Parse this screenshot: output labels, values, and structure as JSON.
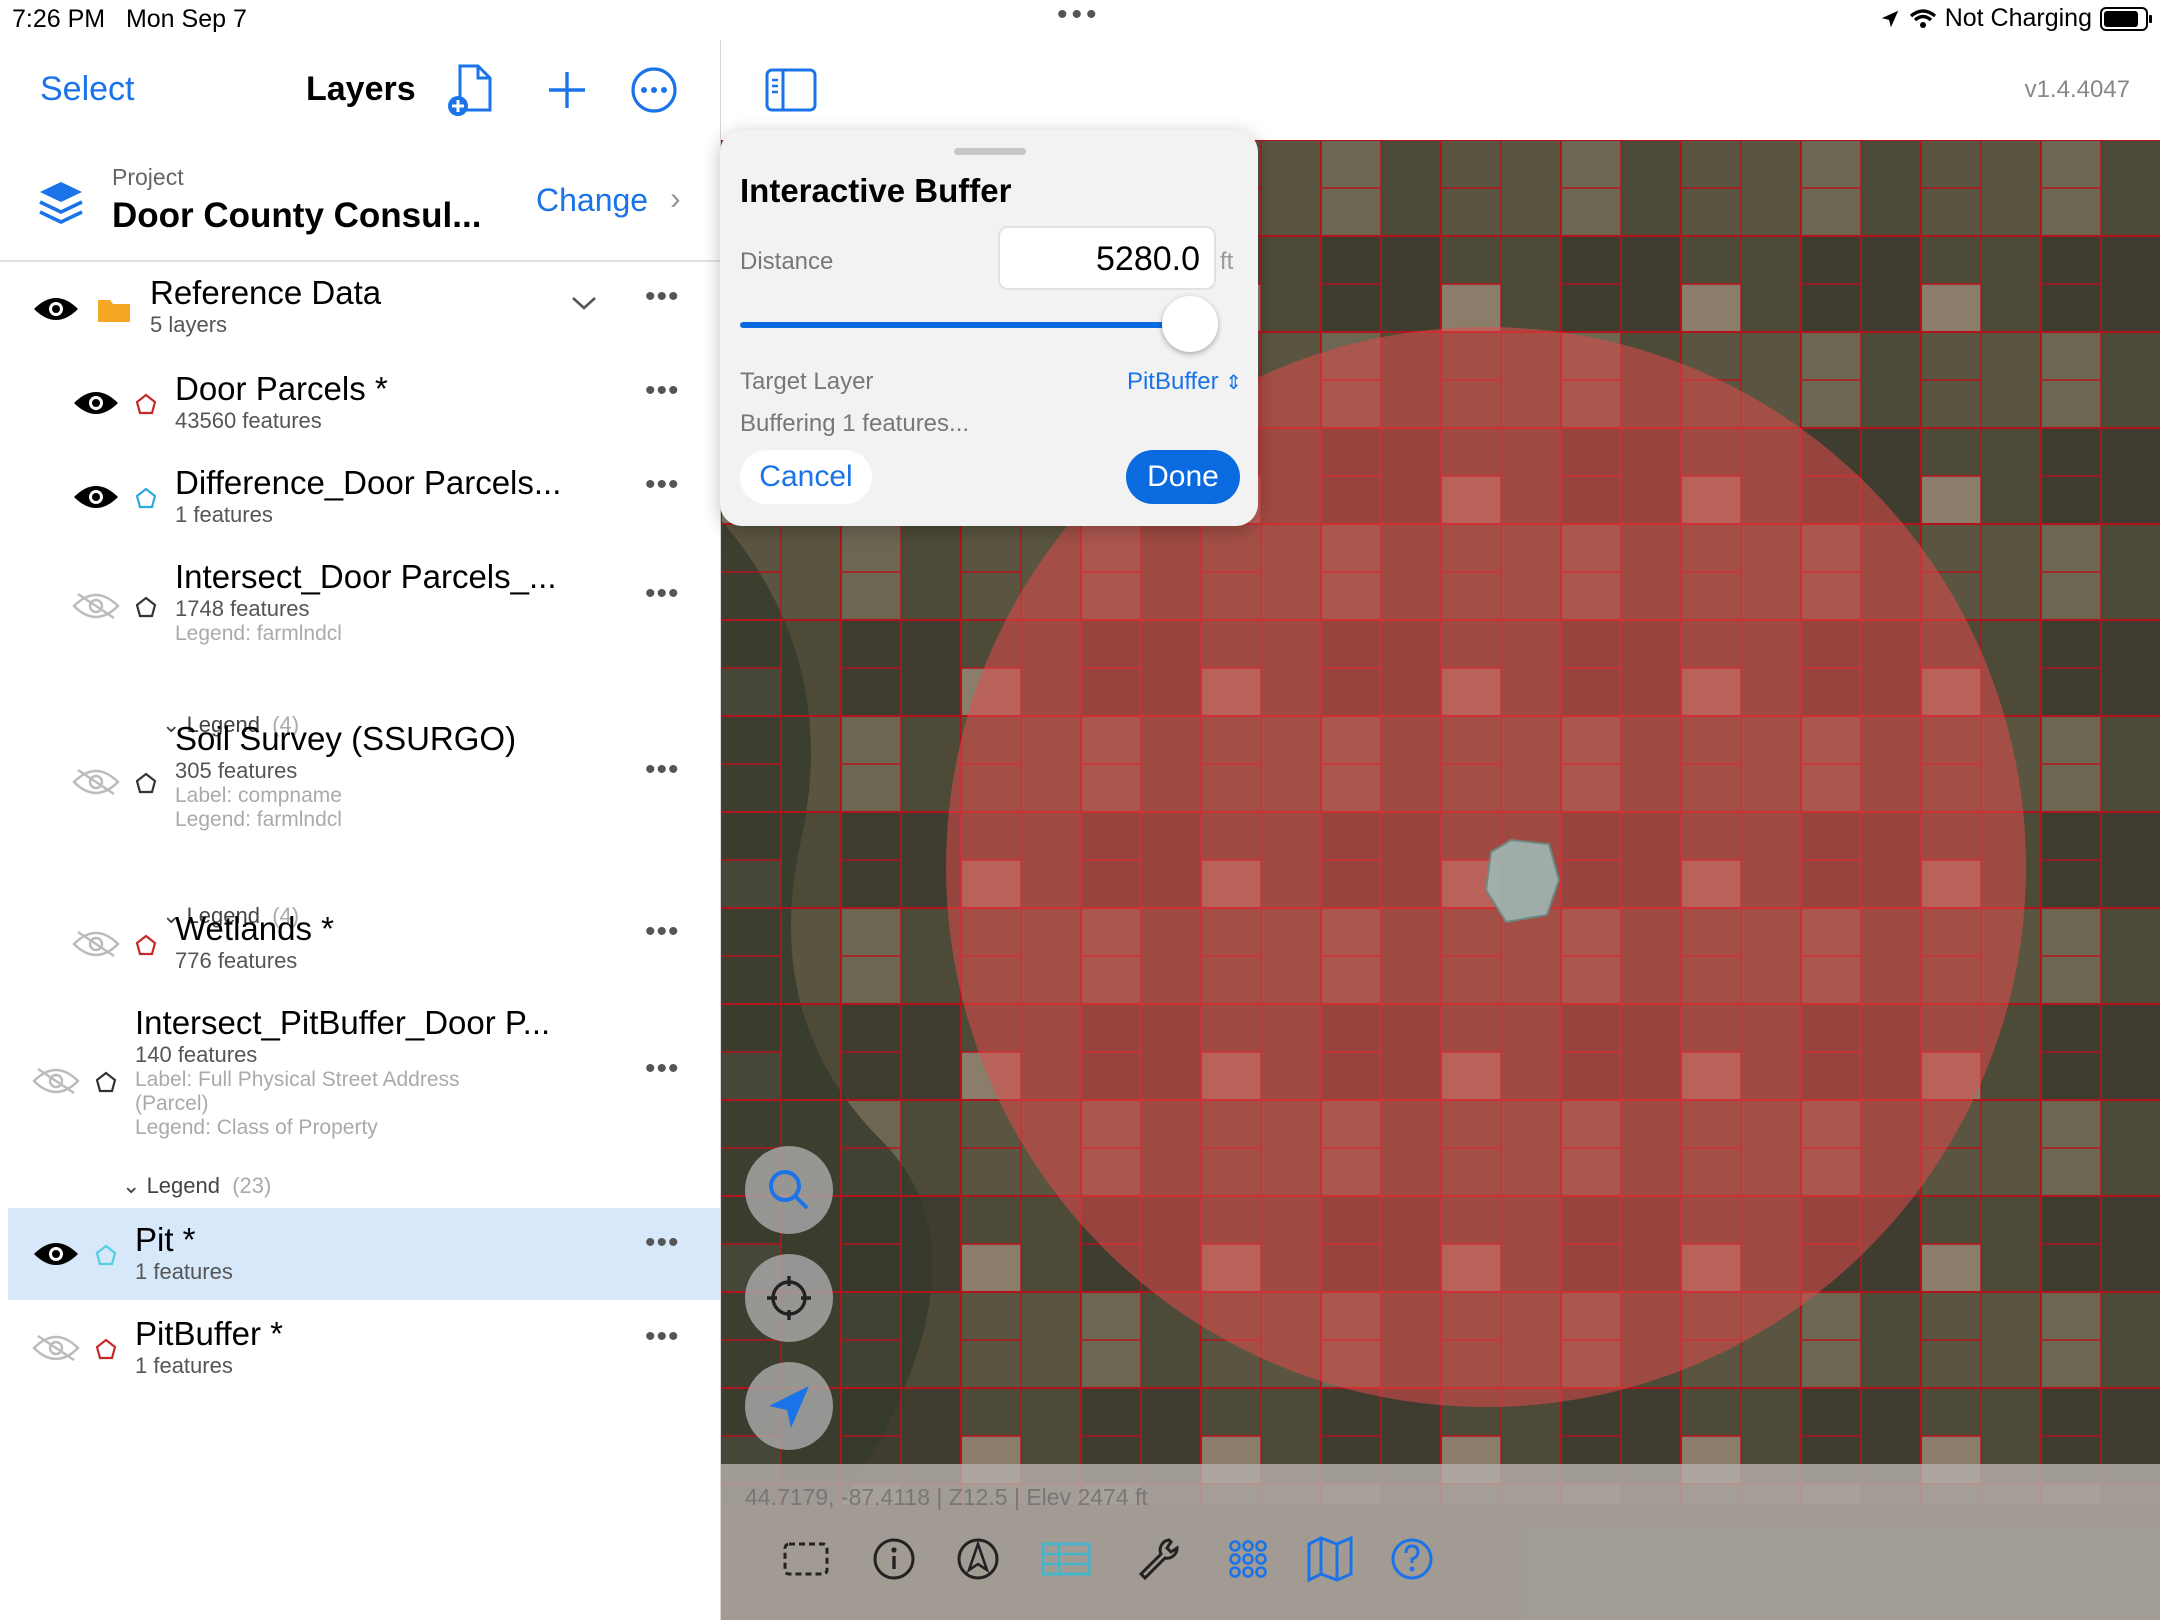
{
  "status_bar": {
    "time": "7:26 PM",
    "date": "Mon Sep 7",
    "battery_text": "Not Charging"
  },
  "sidebar": {
    "select_label": "Select",
    "title": "Layers",
    "icons": [
      "add-document-icon",
      "plus-icon",
      "more-circle-icon"
    ],
    "project_caption": "Project",
    "project_name": "Door County Consul...",
    "change_label": "Change",
    "group": {
      "title": "Reference Data",
      "subtitle": "5 layers"
    },
    "layers": [
      {
        "name": "Door Parcels *",
        "features": "43560 features",
        "visible": true,
        "color": "#c62828"
      },
      {
        "name": "Difference_Door Parcels...",
        "features": "1 features",
        "visible": true,
        "color": "#29a9e0"
      },
      {
        "name": "Intersect_Door Parcels_...",
        "features": "1748 features",
        "legend_meta": "Legend: farmlndcl",
        "legend_label": "Legend",
        "legend_count": "(4)",
        "visible": false,
        "color": "#333333"
      },
      {
        "name": "Soil Survey (SSURGO)",
        "features": "305 features",
        "label_meta": "Label: compname",
        "legend_meta": "Legend: farmlndcl",
        "legend_label": "Legend",
        "legend_count": "(4)",
        "visible": false,
        "color": "#333333"
      },
      {
        "name": "Wetlands *",
        "features": "776 features",
        "visible": false,
        "color": "#c62828"
      },
      {
        "name": "Intersect_PitBuffer_Door P...",
        "features": "140 features",
        "label_meta_1": "Label: Full Physical Street Address",
        "label_meta_2": "(Parcel)",
        "legend_meta": "Legend: Class of Property",
        "legend_label": "Legend",
        "legend_count": "(23)",
        "visible": false,
        "color": "#333333"
      },
      {
        "name": "Pit *",
        "features": "1 features",
        "visible": true,
        "selected": true,
        "color": "#4dd0e1"
      },
      {
        "name": "PitBuffer *",
        "features": "1 features",
        "visible": false,
        "color": "#c62828"
      }
    ]
  },
  "map": {
    "version": "v1.4.4047",
    "coords": "44.7179, -87.4118 | Z12.5 | Elev 2474 ft",
    "buffer_color": "#e04a4a",
    "pit_color": "#9fb8b4",
    "parcel_line_color": "#b3141b",
    "toolbar": [
      "select-rect-icon",
      "info-icon",
      "compass-pen-icon",
      "table-icon",
      "wrench-icon",
      "grid-icon",
      "map-icon",
      "help-icon"
    ],
    "fabs": [
      "search-icon",
      "crosshair-icon",
      "location-arrow-icon"
    ]
  },
  "popup": {
    "title": "Interactive Buffer",
    "distance_label": "Distance",
    "distance_value": "5280.0",
    "unit": "ft",
    "slider_fraction": 1.0,
    "target_label": "Target Layer",
    "target_value": "PitBuffer",
    "status": "Buffering 1 features...",
    "cancel": "Cancel",
    "done": "Done"
  }
}
